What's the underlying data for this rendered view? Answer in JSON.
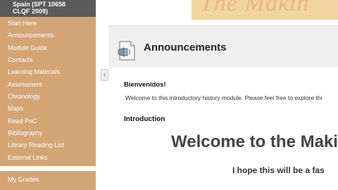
{
  "course": {
    "title_line1": "Spain (SPT 10658",
    "title_line2": "CLQF 2009)"
  },
  "banner": {
    "text": "The Makin"
  },
  "menu": {
    "items": [
      {
        "label": "Start Here"
      },
      {
        "label": "Announcements"
      },
      {
        "label": "Module Guide"
      },
      {
        "label": "Contacts"
      },
      {
        "label": "Learning Materials"
      },
      {
        "label": "Assessment"
      },
      {
        "label": "Chronology"
      },
      {
        "label": "Maps"
      },
      {
        "label": "Read PnC"
      },
      {
        "label": "Bibliography"
      },
      {
        "label": "Library Reading List"
      },
      {
        "label": "External Links"
      }
    ],
    "tools": [
      {
        "label": "My Grades"
      }
    ]
  },
  "sidebar_toggle": {
    "icon": "chevron-left-icon",
    "glyph": "‹"
  },
  "page": {
    "title": "Announcements",
    "icon": "announcement-page-icon"
  },
  "content": {
    "greeting": "Bienvenidos!",
    "welcome_text": "Welcome to this introductory history module. Please feel free to explore thi",
    "intro_heading": "Introduction",
    "big_heading": "Welcome to the Maki",
    "sub_heading": "I hope this will be a fas"
  },
  "colors": {
    "sidebar": "#d4a574",
    "course_header": "#5a5a5a",
    "banner": "#f2d49e"
  }
}
